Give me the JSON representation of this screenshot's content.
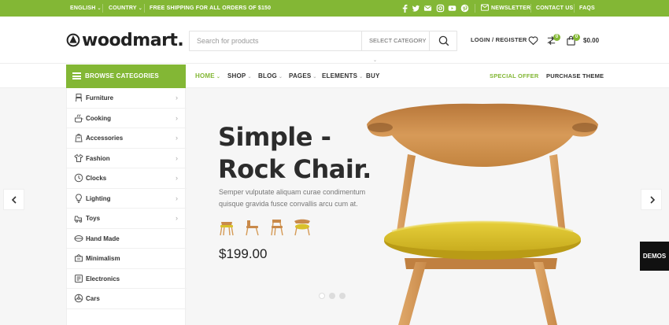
{
  "topbar": {
    "language": "ENGLISH",
    "country": "COUNTRY",
    "promo": "FREE SHIPPING FOR ALL ORDERS OF $150",
    "social_icons": [
      "facebook-icon",
      "twitter-icon",
      "email-icon",
      "instagram-icon",
      "youtube-icon",
      "pinterest-icon"
    ],
    "newsletter": "NEWSLETTER",
    "contact": "CONTACT US",
    "faqs": "FAQS"
  },
  "header": {
    "logo_text": "woodmart.",
    "search_placeholder": "Search for products",
    "search_category": "SELECT CATEGORY",
    "login": "LOGIN / REGISTER",
    "compare_count": "0",
    "cart_count": "0",
    "cart_total": "$0.00"
  },
  "nav": {
    "browse_label": "BROWSE CATEGORIES",
    "items": [
      {
        "label": "HOME",
        "active": true
      },
      {
        "label": "SHOP"
      },
      {
        "label": "BLOG"
      },
      {
        "label": "PAGES"
      },
      {
        "label": "ELEMENTS"
      },
      {
        "label": "BUY"
      }
    ],
    "special_offer": "SPECIAL OFFER",
    "purchase_theme": "PURCHASE THEME"
  },
  "categories": [
    {
      "label": "Furniture",
      "icon": "chair-icon",
      "has_sub": true
    },
    {
      "label": "Cooking",
      "icon": "cooking-icon",
      "has_sub": true
    },
    {
      "label": "Accessories",
      "icon": "accessories-icon",
      "has_sub": true
    },
    {
      "label": "Fashion",
      "icon": "fashion-icon",
      "has_sub": true
    },
    {
      "label": "Clocks",
      "icon": "clock-icon",
      "has_sub": true
    },
    {
      "label": "Lighting",
      "icon": "lightbulb-icon",
      "has_sub": true
    },
    {
      "label": "Toys",
      "icon": "toy-icon",
      "has_sub": true
    },
    {
      "label": "Hand Made",
      "icon": "handmade-icon",
      "has_sub": false
    },
    {
      "label": "Minimalism",
      "icon": "minimalism-icon",
      "has_sub": false
    },
    {
      "label": "Electronics",
      "icon": "electronics-icon",
      "has_sub": false
    },
    {
      "label": "Cars",
      "icon": "car-icon",
      "has_sub": false
    }
  ],
  "hero": {
    "title_line1": "Simple -",
    "title_line2": "Rock Chair.",
    "subtitle": "Semper vulputate aliquam curae condimentum quisque gravida fusce convallis arcu cum at.",
    "price": "$199.00",
    "slides": 3,
    "active_slide": 1
  },
  "demos_label": "DEMOS",
  "colors": {
    "accent": "#83b735",
    "chair_wood": "#c98a4a",
    "chair_seat": "#d9c12a",
    "dark": "#222222"
  }
}
